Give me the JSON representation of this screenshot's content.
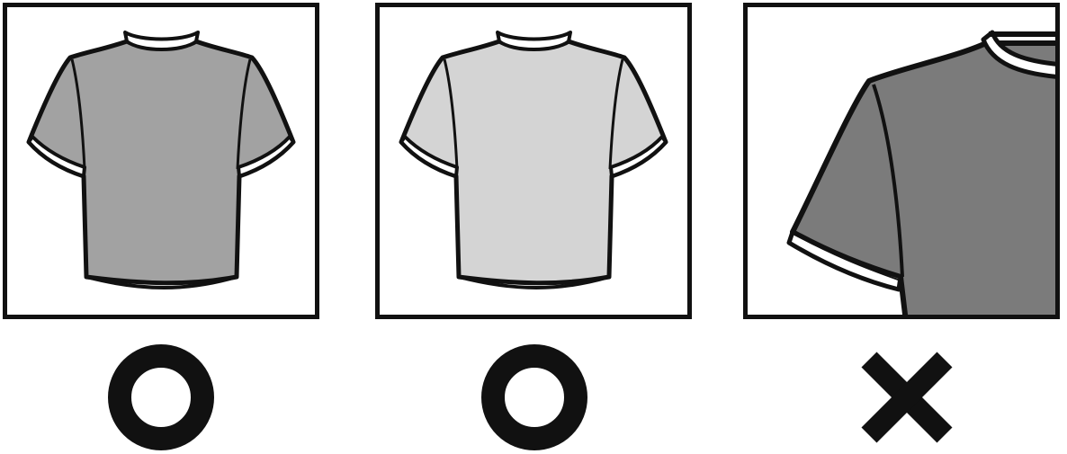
{
  "panels": [
    {
      "id": "panel-1",
      "content": "tshirt-full",
      "shirt_color": "#a2a2a2",
      "mark": "circle-icon"
    },
    {
      "id": "panel-2",
      "content": "tshirt-full",
      "shirt_color": "#d4d4d4",
      "mark": "circle-icon"
    },
    {
      "id": "panel-3",
      "content": "tshirt-cropped-zoom",
      "shirt_color": "#7b7b7b",
      "mark": "cross-icon"
    }
  ],
  "colors": {
    "outline": "#111111",
    "background": "#ffffff"
  }
}
